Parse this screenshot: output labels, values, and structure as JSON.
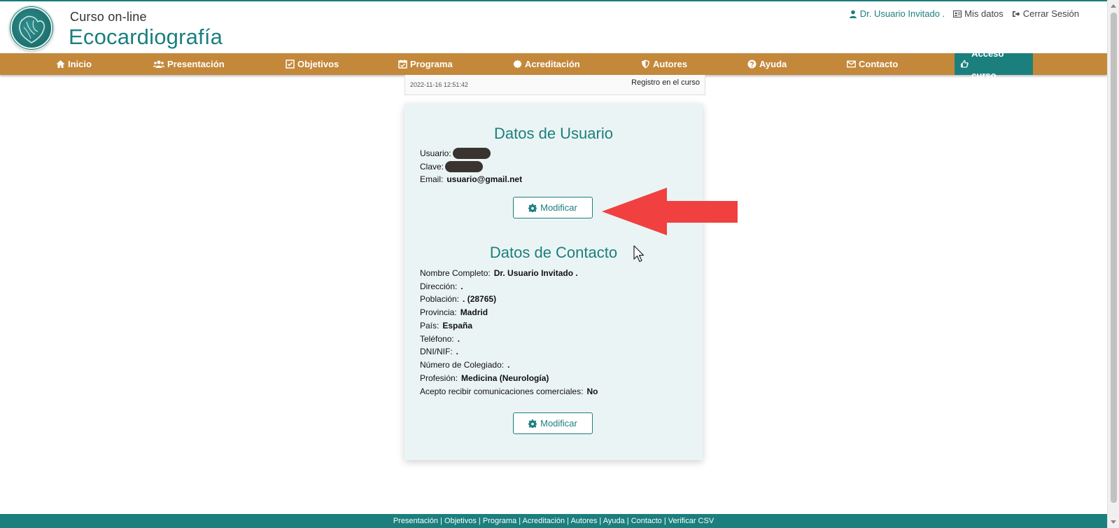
{
  "header": {
    "brand_small": "Curso  on-line",
    "brand_big": "Ecocardiografía",
    "user_name": "Dr. Usuario Invitado .",
    "my_data": "Mis datos",
    "logout": "Cerrar Sesión"
  },
  "nav": {
    "items": [
      {
        "label": "Inicio",
        "icon": "home-icon"
      },
      {
        "label": "Presentación",
        "icon": "users-icon"
      },
      {
        "label": "Objetivos",
        "icon": "checkbox-icon"
      },
      {
        "label": "Programa",
        "icon": "calendar-check-icon"
      },
      {
        "label": "Acreditación",
        "icon": "certificate-icon"
      },
      {
        "label": "Autores",
        "icon": "shield-icon"
      },
      {
        "label": "Ayuda",
        "icon": "question-icon"
      },
      {
        "label": "Contacto",
        "icon": "envelope-icon"
      },
      {
        "label": "Acceso curso",
        "icon": "hand-point-icon"
      }
    ],
    "active": "Acceso curso"
  },
  "registro": {
    "fecha": "2022-11-16 12:51:42",
    "evento": "Registro en el curso"
  },
  "usuario": {
    "title": "Datos de Usuario",
    "usuario_label": "Usuario:",
    "clave_label": "Clave:",
    "email_label": "Email:",
    "email_value": "usuario@gmail.net",
    "button": "Modificar"
  },
  "contacto": {
    "title": "Datos de Contacto",
    "fields": [
      {
        "label": "Nombre Completo:",
        "value": "Dr. Usuario Invitado ."
      },
      {
        "label": "Dirección:",
        "value": "."
      },
      {
        "label": "Población:",
        "value": ". (28765)"
      },
      {
        "label": "Provincia:",
        "value": "Madrid"
      },
      {
        "label": "País:",
        "value": "España"
      },
      {
        "label": "Teléfono:",
        "value": "."
      },
      {
        "label": "DNI/NIF:",
        "value": "."
      },
      {
        "label": "Número de Colegiado:",
        "value": "."
      },
      {
        "label": "Profesión:",
        "value": "Medicina (Neurología)"
      },
      {
        "label": "Acepto recibir comunicaciones comerciales:",
        "value": "No"
      }
    ],
    "button": "Modificar"
  },
  "footer": {
    "links": [
      "Presentación",
      "Objetivos",
      "Programa",
      "Acreditación",
      "Autores",
      "Ayuda",
      "Contacto",
      "Verificar CSV"
    ],
    "separator": " | "
  },
  "colors": {
    "teal": "#1b7f7e",
    "nav_orange": "#c4883b",
    "card_bg": "#ebf4f4",
    "arrow_red": "#f04040"
  }
}
